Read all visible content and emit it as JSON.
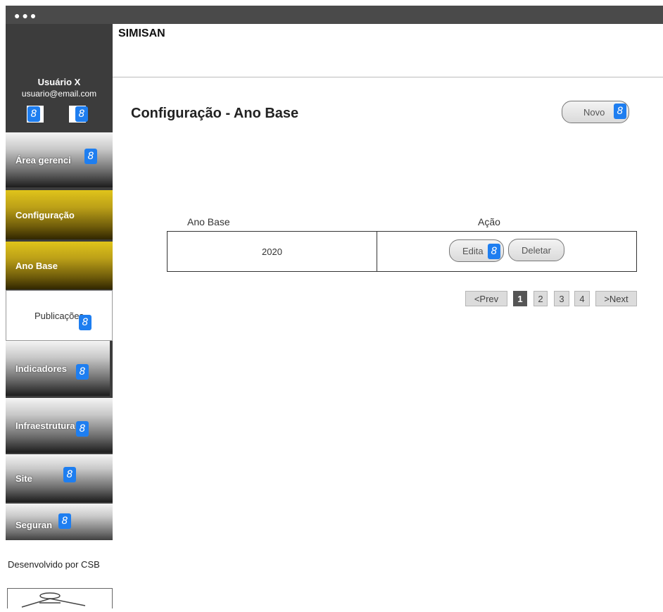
{
  "window": {
    "dots": "●●●"
  },
  "app": {
    "brand": "SIMISAN"
  },
  "user": {
    "name": "Usuário X",
    "email": "usuario@email.com"
  },
  "sidebar": {
    "items": [
      {
        "label": "Área gerenci",
        "style": "gray"
      },
      {
        "label": "Configuração",
        "style": "gold"
      },
      {
        "label": "Ano Base",
        "style": "gold"
      },
      {
        "label": "Publicações",
        "style": "white"
      },
      {
        "label": "Indicadores",
        "style": "gray"
      },
      {
        "label": "Infraestrutura",
        "style": "gray"
      },
      {
        "label": "Site",
        "style": "gray"
      },
      {
        "label": "Seguran",
        "style": "gray"
      }
    ],
    "footer": "Desenvolvido por CSB"
  },
  "page": {
    "title": "Configuração - Ano Base",
    "new_button": "Novo"
  },
  "table": {
    "columns": [
      "Ano Base",
      "Ação"
    ],
    "rows": [
      {
        "year": "2020",
        "edit_label": "Edita",
        "delete_label": "Deletar"
      }
    ]
  },
  "pagination": {
    "prev": "<Prev",
    "pages": [
      "1",
      "2",
      "3",
      "4"
    ],
    "current": "1",
    "next": ">Next"
  },
  "link_badge_glyph": "8",
  "colors": {
    "sidebar_bg": "#3c3c3c",
    "active_gold": "#bca018",
    "link_badge": "#1e7ef0"
  }
}
